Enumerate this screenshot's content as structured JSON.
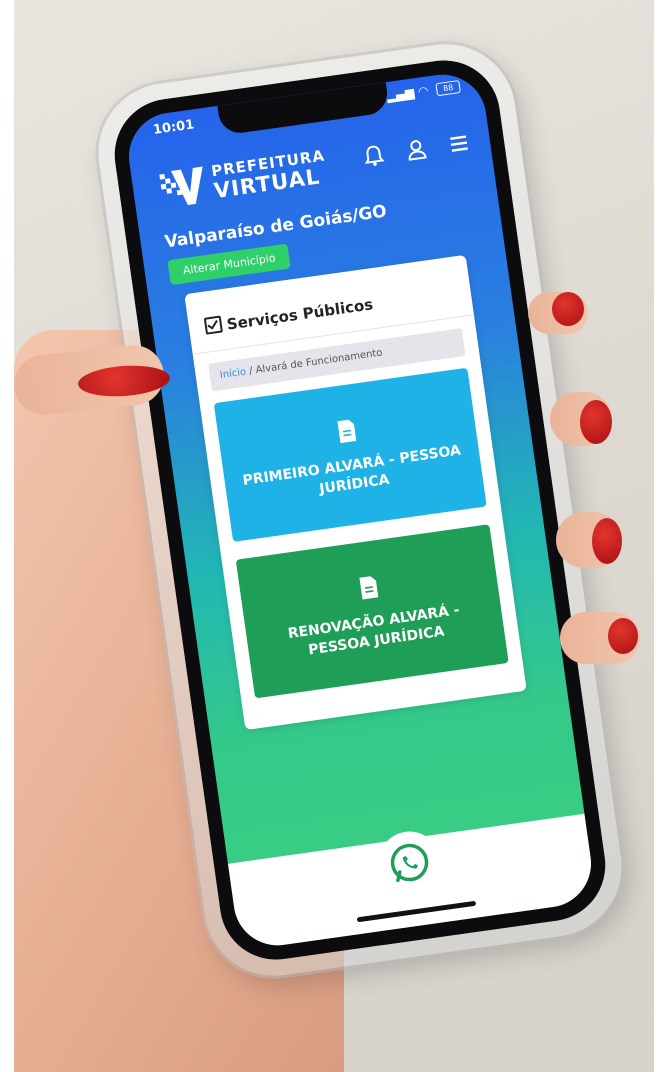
{
  "status_bar": {
    "time": "10:01",
    "battery": "88"
  },
  "header": {
    "logo_line1": "PREFEITURA",
    "logo_line2": "VIRTUAL",
    "icons": [
      "bell-icon",
      "user-icon",
      "menu-icon"
    ]
  },
  "location": {
    "city": "Valparaíso de Goiás/GO",
    "change_button": "Alterar Município"
  },
  "card": {
    "title": "Serviços Públicos",
    "breadcrumb": {
      "home": "Início",
      "separator": "/",
      "current": "Alvará de Funcionamento"
    },
    "tiles": [
      {
        "label": "PRIMEIRO ALVARÁ - PESSOA JURÍDICA",
        "color": "#1eb2e6",
        "icon": "document-icon"
      },
      {
        "label": "RENOVAÇÃO ALVARÁ - PESSOA JURÍDICA",
        "color": "#1f9e58",
        "icon": "document-icon"
      }
    ]
  },
  "footer": {
    "icon": "whatsapp-icon"
  },
  "colors": {
    "gradient_top": "#2563eb",
    "gradient_bottom": "#3ccf7f",
    "accent_green": "#2fcf6a"
  }
}
